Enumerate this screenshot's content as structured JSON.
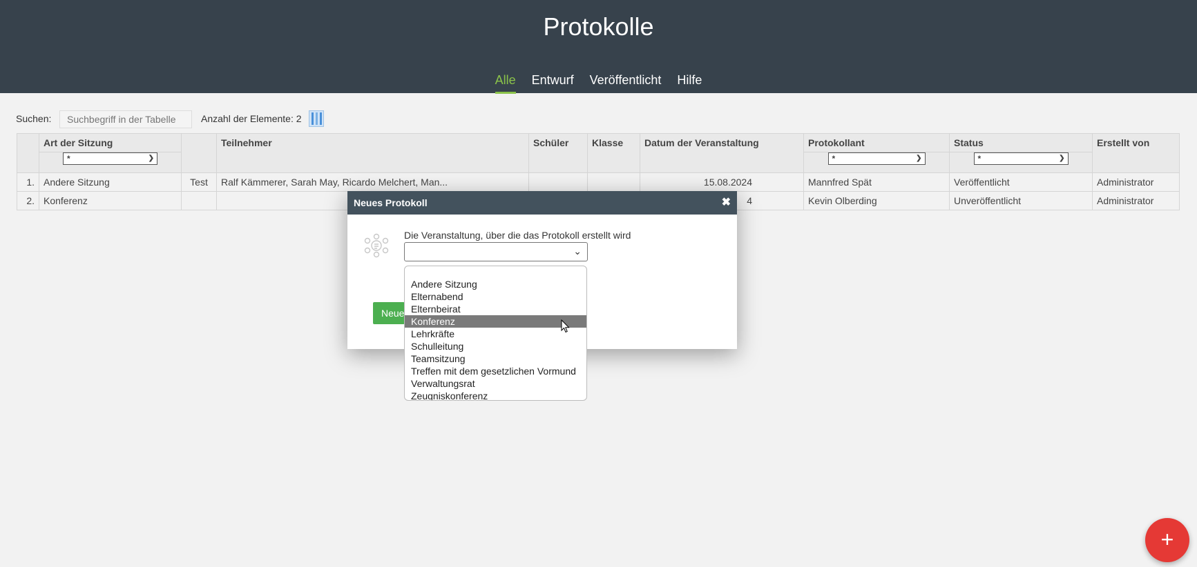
{
  "header": {
    "title": "Protokolle",
    "tabs": [
      "Alle",
      "Entwurf",
      "Veröffentlicht",
      "Hilfe"
    ],
    "active_tab": "Alle"
  },
  "toolbar": {
    "search_label": "Suchen:",
    "search_placeholder": "Suchbegriff in der Tabelle",
    "count_label": "Anzahl der Elemente: 2"
  },
  "table": {
    "columns": [
      "Art der Sitzung",
      "",
      "Teilnehmer",
      "Schüler",
      "Klasse",
      "Datum der Veranstaltung",
      "Protokollant",
      "Status",
      "Erstellt von"
    ],
    "filter_value": "*",
    "rows": [
      {
        "num": "1.",
        "art": "Andere Sitzung",
        "titel": "Test",
        "teilnehmer": "Ralf Kämmerer, Sarah May, Ricardo Melchert, Man...",
        "schueler": "",
        "klasse": "",
        "datum": "15.08.2024",
        "protokollant": "Mannfred Spät",
        "status": "Veröffentlicht",
        "erstellt": "Administrator"
      },
      {
        "num": "2.",
        "art": "Konferenz",
        "titel": "",
        "teilnehmer": "",
        "schueler": "",
        "klasse": "",
        "datum": "4",
        "protokollant": "Kevin Olberding",
        "status": "Unveröffentlicht",
        "erstellt": "Administrator"
      }
    ]
  },
  "dialog": {
    "title": "Neues Protokoll",
    "field_label": "Die Veranstaltung, über die das Protokoll erstellt wird",
    "button_label": "Neue",
    "options": [
      "Andere Sitzung",
      "Elternabend",
      "Elternbeirat",
      "Konferenz",
      "Lehrkräfte",
      "Schulleitung",
      "Teamsitzung",
      "Treffen mit dem gesetzlichen Vormund",
      "Verwaltungsrat",
      "Zeugniskonferenz"
    ],
    "highlighted_option": "Konferenz"
  },
  "fab": {
    "label": "+"
  },
  "icons": {
    "close": "close-icon",
    "meeting": "meeting-icon",
    "fab": "plus-icon"
  }
}
